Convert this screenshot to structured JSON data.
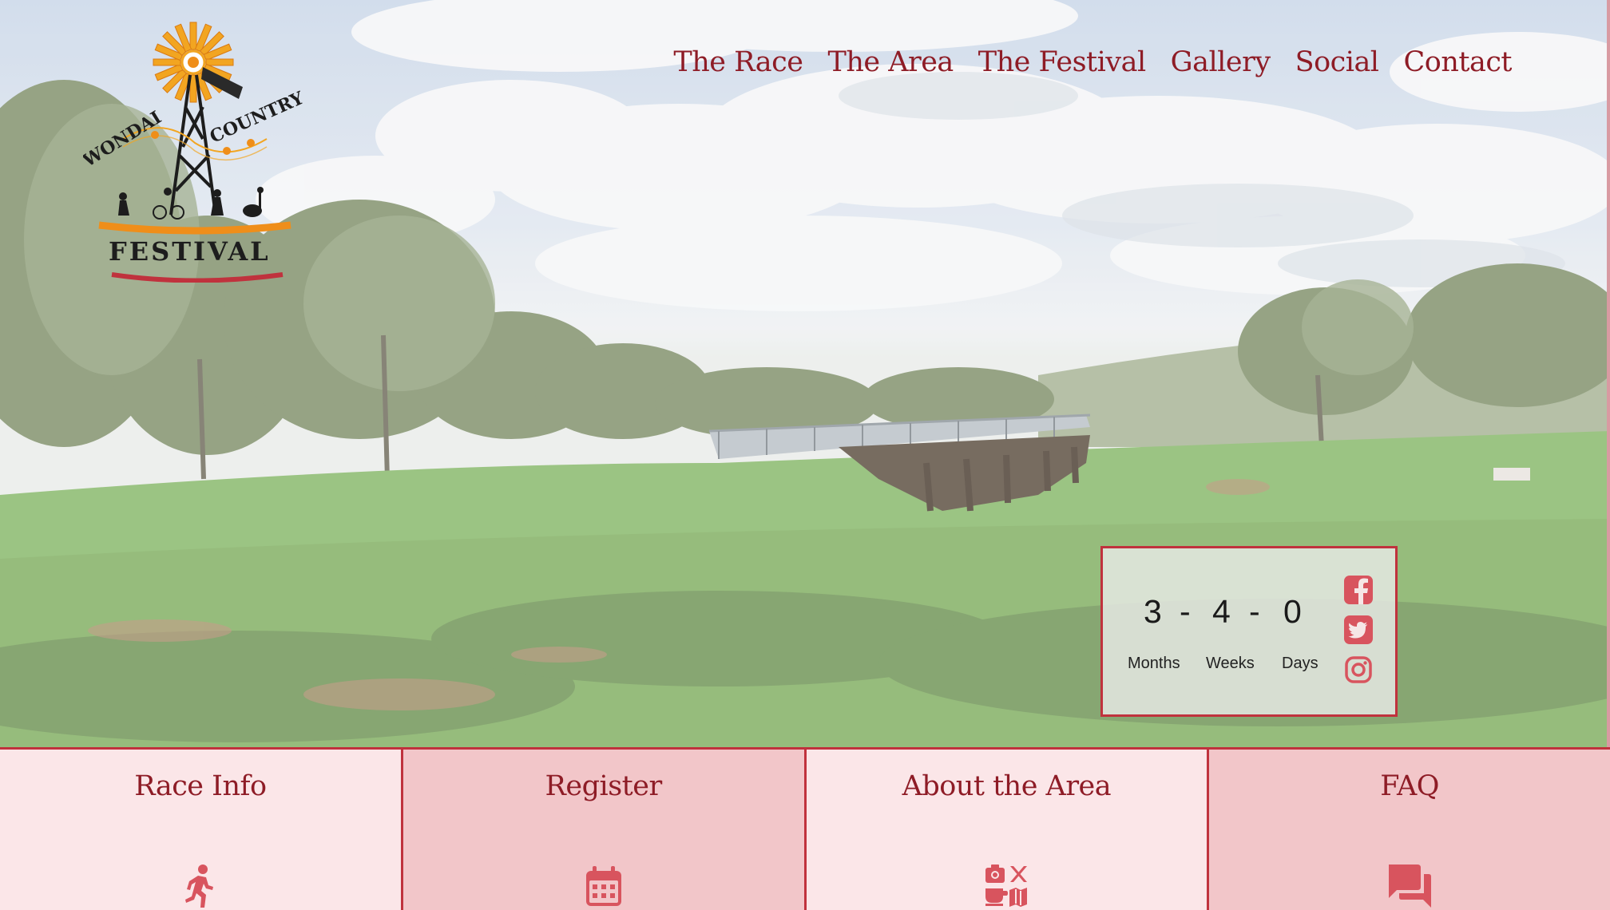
{
  "logo": {
    "top_left_text": "WONDAI",
    "top_right_text": "COUNTRY",
    "bottom_text": "FESTIVAL"
  },
  "nav": {
    "items": [
      {
        "label": "The Race"
      },
      {
        "label": "The Area"
      },
      {
        "label": "The Festival"
      },
      {
        "label": "Gallery"
      },
      {
        "label": "Social"
      },
      {
        "label": "Contact"
      }
    ]
  },
  "countdown": {
    "months": "3",
    "weeks": "4",
    "days": "0",
    "separator": "-",
    "labels": {
      "months": "Months",
      "weeks": "Weeks",
      "days": "Days"
    },
    "social_icons": [
      "facebook-icon",
      "twitter-icon",
      "instagram-icon"
    ]
  },
  "tiles": [
    {
      "title": "Race Info",
      "icon": "running-icon"
    },
    {
      "title": "Register",
      "icon": "calendar-icon"
    },
    {
      "title": "About the Area",
      "icon": "attractions-icon"
    },
    {
      "title": "FAQ",
      "icon": "forum-icon"
    }
  ],
  "colors": {
    "accent": "#8e1c26",
    "border": "#c0323d",
    "icon": "#d8545e",
    "tile_light": "#fbe6e8",
    "tile_dark": "#f2c6c9"
  }
}
